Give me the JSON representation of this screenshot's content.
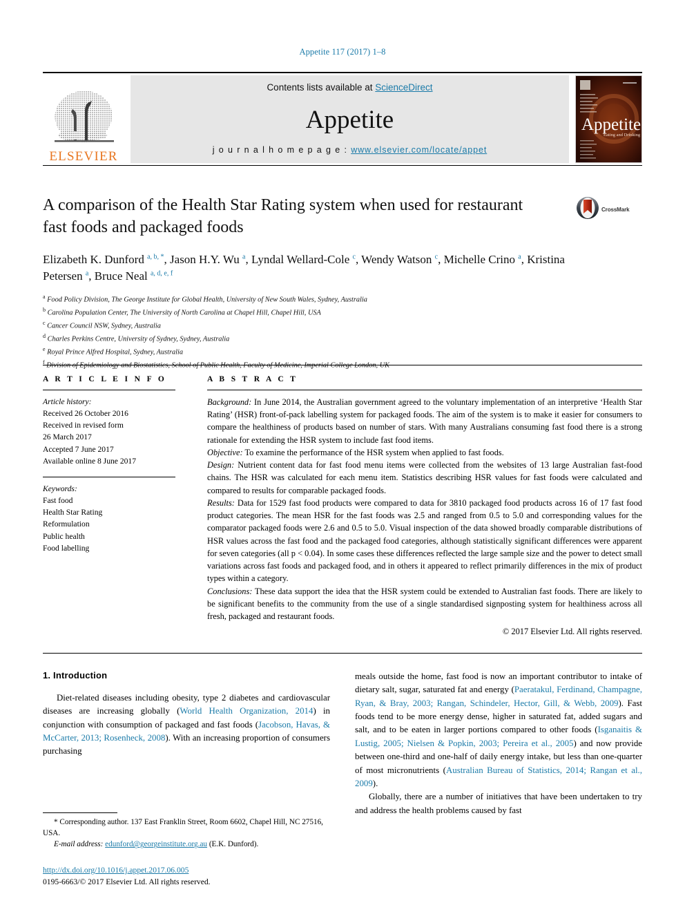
{
  "running_head": "Appetite 117 (2017) 1–8",
  "masthead": {
    "contents_prefix": "Contents lists available at ",
    "sciencedirect": "ScienceDirect",
    "journal_name": "Appetite",
    "homepage_label": "j o u r n a l   h o m e p a g e :  ",
    "homepage_url": "www.elsevier.com/locate/appet",
    "publisher": "ELSEVIER",
    "cover_title": "Appetite",
    "cover_subtitle": "Eating and Drinking",
    "accent_blue": "#1a7aa8",
    "elsevier_orange": "#e87722"
  },
  "title": "A comparison of the Health Star Rating system when used for restaurant fast foods and packaged foods",
  "crossmark_label": "CrossMark",
  "authors_html": "Elizabeth K. Dunford <sup>a, b, *</sup>, Jason H.Y. Wu <sup>a</sup>, Lyndal Wellard-Cole <sup>c</sup>, Wendy Watson <sup>c</sup>, Michelle Crino <sup>a</sup>, Kristina Petersen <sup>a</sup>, Bruce Neal <sup>a, d, e, f</sup>",
  "affiliations": [
    {
      "mark": "a",
      "text": "Food Policy Division, The George Institute for Global Health, University of New South Wales, Sydney, Australia"
    },
    {
      "mark": "b",
      "text": "Carolina Population Center, The University of North Carolina at Chapel Hill, Chapel Hill, USA"
    },
    {
      "mark": "c",
      "text": "Cancer Council NSW, Sydney, Australia"
    },
    {
      "mark": "d",
      "text": "Charles Perkins Centre, University of Sydney, Sydney, Australia"
    },
    {
      "mark": "e",
      "text": "Royal Prince Alfred Hospital, Sydney, Australia"
    },
    {
      "mark": "f",
      "text": "Division of Epidemiology and Biostatistics, School of Public Health, Faculty of Medicine, Imperial College London, UK"
    }
  ],
  "article_info": {
    "heading": "A R T I C L E  I N F O",
    "history_label": "Article history:",
    "history_lines": [
      "Received 26 October 2016",
      "Received in revised form",
      "26 March 2017",
      "Accepted 7 June 2017",
      "Available online 8 June 2017"
    ],
    "keywords_label": "Keywords:",
    "keywords": [
      "Fast food",
      "Health Star Rating",
      "Reformulation",
      "Public health",
      "Food labelling"
    ]
  },
  "abstract": {
    "heading": "A B S T R A C T",
    "sections": [
      {
        "label": "Background:",
        "text": " In June 2014, the Australian government agreed to the voluntary implementation of an interpretive ‘Health Star Rating’ (HSR) front-of-pack labelling system for packaged foods. The aim of the system is to make it easier for consumers to compare the healthiness of products based on number of stars. With many Australians consuming fast food there is a strong rationale for extending the HSR system to include fast food items."
      },
      {
        "label": "Objective:",
        "text": " To examine the performance of the HSR system when applied to fast foods."
      },
      {
        "label": "Design:",
        "text": " Nutrient content data for fast food menu items were collected from the websites of 13 large Australian fast-food chains. The HSR was calculated for each menu item. Statistics describing HSR values for fast foods were calculated and compared to results for comparable packaged foods."
      },
      {
        "label": "Results:",
        "text": " Data for 1529 fast food products were compared to data for 3810 packaged food products across 16 of 17 fast food product categories. The mean HSR for the fast foods was 2.5 and ranged from 0.5 to 5.0 and corresponding values for the comparator packaged foods were 2.6 and 0.5 to 5.0. Visual inspection of the data showed broadly comparable distributions of HSR values across the fast food and the packaged food categories, although statistically significant differences were apparent for seven categories (all p < 0.04). In some cases these differences reflected the large sample size and the power to detect small variations across fast foods and packaged food, and in others it appeared to reflect primarily differences in the mix of product types within a category."
      },
      {
        "label": "Conclusions:",
        "text": " These data support the idea that the HSR system could be extended to Australian fast foods. There are likely to be significant benefits to the community from the use of a single standardised signposting system for healthiness across all fresh, packaged and restaurant foods."
      }
    ],
    "copyright": "© 2017 Elsevier Ltd. All rights reserved."
  },
  "body": {
    "section_heading": "1. Introduction",
    "left_paragraph_html": "Diet-related diseases including obesity, type 2 diabetes and cardiovascular diseases are increasing globally (<span class=\"ref\">World Health Organization, 2014</span>) in conjunction with consumption of packaged and fast foods (<span class=\"ref\">Jacobson, Havas, &amp; McCarter, 2013; Rosenheck, 2008</span>). With an increasing proportion of consumers purchasing",
    "right_paragraph_1_html": "meals outside the home, fast food is now an important contributor to intake of dietary salt, sugar, saturated fat and energy (<span class=\"ref\">Paeratakul, Ferdinand, Champagne, Ryan, &amp; Bray, 2003; Rangan, Schindeler, Hector, Gill, &amp; Webb, 2009</span>). Fast foods tend to be more energy dense, higher in saturated fat, added sugars and salt, and to be eaten in larger portions compared to other foods (<span class=\"ref\">Isganaitis &amp; Lustig, 2005; Nielsen &amp; Popkin, 2003; Pereira et al., 2005</span>) and now provide between one-third and one-half of daily energy intake, but less than one-quarter of most micronutrients (<span class=\"ref\">Australian Bureau of Statistics, 2014; Rangan et al., 2009</span>).",
    "right_paragraph_2_html": "Globally, there are a number of initiatives that have been undertaken to try and address the health problems caused by fast"
  },
  "footnote": {
    "corresponding_html": "* Corresponding author. 137 East Franklin Street, Room 6602, Chapel Hill, NC 27516, USA.",
    "email_label": "E-mail address:",
    "email": "edunford@georgeinstitute.org.au",
    "email_owner": "(E.K. Dunford)."
  },
  "imprint": {
    "doi": "http://dx.doi.org/10.1016/j.appet.2017.06.005",
    "issn_line": "0195-6663/© 2017 Elsevier Ltd. All rights reserved."
  }
}
